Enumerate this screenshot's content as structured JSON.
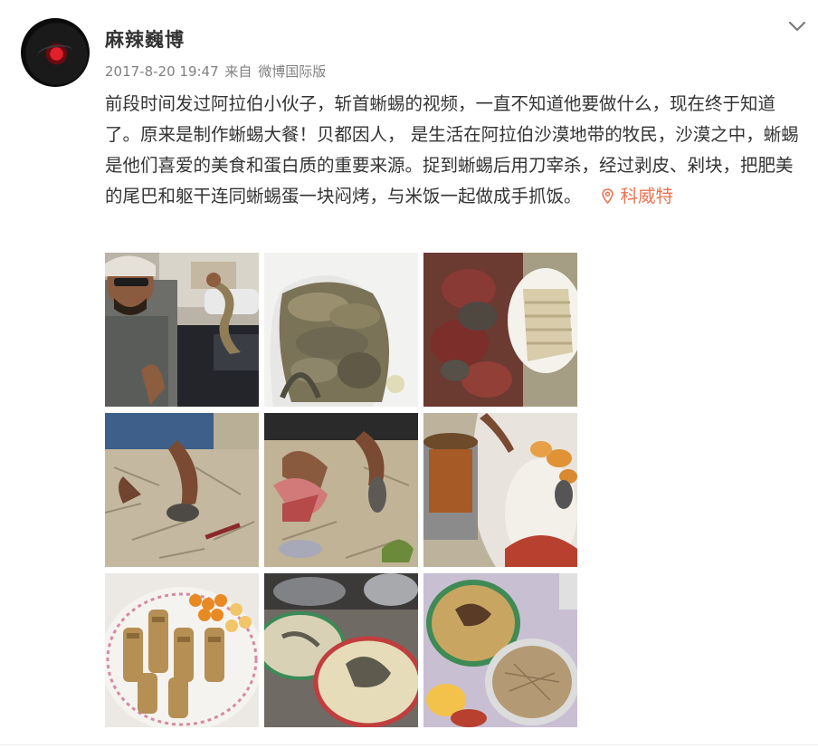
{
  "post": {
    "username": "麻辣巍博",
    "timestamp": "2017-8-20 19:47",
    "source_prefix": "来自",
    "source": "微博国际版",
    "text": "前段时间发过阿拉伯小伙子，斩首蜥蜴的视频，一直不知道他要做什么，现在终于知道了。原来是制作蜥蜴大餐！贝都因人， 是生活在阿拉伯沙漠地带的牧民，沙漠之中，蜥蜴是他们喜爱的美食和蛋白质的重要来源。捉到蜥蜴后用刀宰杀，经过剥皮、剁块，把肥美的尾巴和躯干连同蜥蜴蛋一块闷烤，与米饭一起做成手抓饭。",
    "location": "科威特"
  },
  "icons": {
    "menu": "chevron-down-icon",
    "location": "location-pin-icon"
  },
  "colors": {
    "text": "#333333",
    "meta": "#808080",
    "location": "#eb7350"
  }
}
